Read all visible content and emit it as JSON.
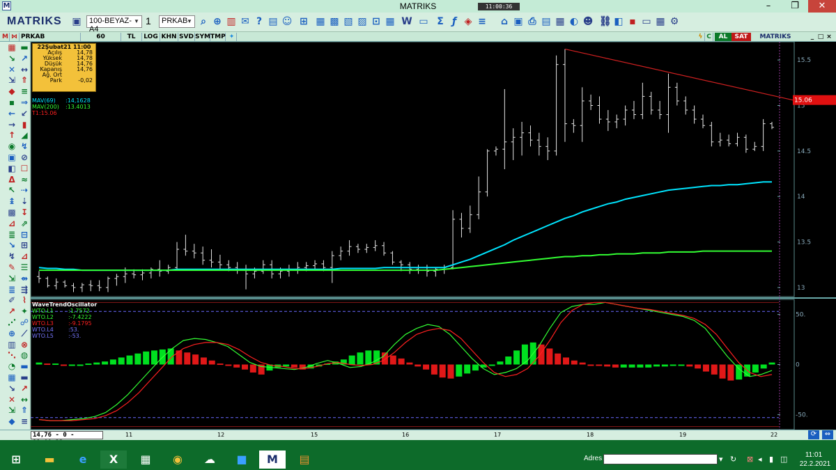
{
  "window": {
    "app_icon": "M",
    "title": "MATRIKS",
    "clock": "11:00:36",
    "minimize": "–",
    "maximize": "❐",
    "close": "✕"
  },
  "toolbar": {
    "logo": "MATRIKS",
    "template_select": "100-BEYAZ-A4",
    "window_select": "1",
    "symbol_select": "PRKAB",
    "icons": [
      "save-icon",
      "search-icon",
      "zoom-icon",
      "chart-icon",
      "email-icon",
      "help-icon",
      "bar-chart-icon",
      "news-icon",
      "web-icon",
      "table-icon",
      "tools-icon",
      "formula-icon",
      "fx-icon",
      "alert-icon",
      "bold-icon",
      "font-color-icon",
      "paint-icon",
      "settings-icon"
    ]
  },
  "chart_header": {
    "symbol": "PRKAB",
    "tabs": [
      "60",
      "TL",
      "LOG",
      "KHN",
      "SVD",
      "SYM",
      "TMP"
    ],
    "al": "AL",
    "sat": "SAT",
    "logo": "MATRIKS"
  },
  "info_box": {
    "title": "22Şubat21 11:00",
    "rows": [
      {
        "label": "Açılış",
        "value": "14,78"
      },
      {
        "label": "Yüksek",
        "value": "14,78"
      },
      {
        "label": "Düşük",
        "value": "14,76"
      },
      {
        "label": "Kapanış",
        "value": "14,76"
      },
      {
        "label": "Ağ. Ort",
        "value": ""
      },
      {
        "label": "Park",
        "value": "-0,02"
      }
    ]
  },
  "indicators_main": [
    {
      "name": "MAV(69)",
      "value": ":14,1628",
      "color": "#00e5ff"
    },
    {
      "name": "MAV(200)",
      "value": ":13.4013",
      "color": "#33ff33"
    },
    {
      "name": "T1:15.06",
      "value": "",
      "color": "#ff2020"
    }
  ],
  "indicators_osc": {
    "title": "WaveTrendOscillator",
    "lines": [
      {
        "name": "WTO.L1",
        "value": ":1.7572",
        "color": "#33ff33"
      },
      {
        "name": "WTO.L2",
        "value": ":-7.4222",
        "color": "#33ff33"
      },
      {
        "name": "WTO.L3",
        "value": ":-9.1795",
        "color": "#ff2020"
      },
      {
        "name": "WTO.L4",
        "value": ":53.",
        "color": "#7777ff"
      },
      {
        "name": "WTO.L5",
        "value": ":-53.",
        "color": "#7777ff"
      }
    ]
  },
  "chart_data": [
    {
      "type": "ohlc",
      "ylim": [
        12.9,
        15.7
      ],
      "y_ticks": [
        "15.5",
        "15",
        "14.5",
        "14",
        "13.5",
        "13"
      ],
      "price_label": "15.06",
      "trendline": {
        "from_price": 15.62,
        "to_price": 15.06
      },
      "bars": [
        [
          13.12,
          13.18,
          13.05,
          13.1
        ],
        [
          13.1,
          13.12,
          13.0,
          13.02
        ],
        [
          13.02,
          13.1,
          12.98,
          13.06
        ],
        [
          13.06,
          13.08,
          13.0,
          13.02
        ],
        [
          13.02,
          13.05,
          12.95,
          13.0
        ],
        [
          13.0,
          13.05,
          12.95,
          13.03
        ],
        [
          13.03,
          13.08,
          12.96,
          13.02
        ],
        [
          13.02,
          13.08,
          12.96,
          13.0
        ],
        [
          13.0,
          13.12,
          12.95,
          13.1
        ],
        [
          13.1,
          13.15,
          13.02,
          13.12
        ],
        [
          13.12,
          13.22,
          13.05,
          13.15
        ],
        [
          13.15,
          13.2,
          13.1,
          13.14
        ],
        [
          13.14,
          13.2,
          13.08,
          13.16
        ],
        [
          13.16,
          13.22,
          13.1,
          13.2
        ],
        [
          13.2,
          13.3,
          13.12,
          13.18
        ],
        [
          13.18,
          13.25,
          13.15,
          13.22
        ],
        [
          13.22,
          13.5,
          13.2,
          13.42
        ],
        [
          13.42,
          13.58,
          13.35,
          13.4
        ],
        [
          13.4,
          13.48,
          13.32,
          13.38
        ],
        [
          13.38,
          13.45,
          13.25,
          13.3
        ],
        [
          13.3,
          13.42,
          13.22,
          13.28
        ],
        [
          13.28,
          13.36,
          13.2,
          13.25
        ],
        [
          13.25,
          13.3,
          13.18,
          13.22
        ],
        [
          13.22,
          13.28,
          13.15,
          13.2
        ],
        [
          13.2,
          13.25,
          12.98,
          13.15
        ],
        [
          13.15,
          13.22,
          13.1,
          13.18
        ],
        [
          13.18,
          13.3,
          13.15,
          13.25
        ],
        [
          13.25,
          13.3,
          13.1,
          13.15
        ],
        [
          13.15,
          13.22,
          13.1,
          13.18
        ],
        [
          13.18,
          13.25,
          13.12,
          13.2
        ],
        [
          13.2,
          13.28,
          13.15,
          13.22
        ],
        [
          13.22,
          13.28,
          13.18,
          13.24
        ],
        [
          13.24,
          13.3,
          13.2,
          13.26
        ],
        [
          13.26,
          13.3,
          13.18,
          13.22
        ],
        [
          13.22,
          13.4,
          13.05,
          13.35
        ],
        [
          13.35,
          13.45,
          13.3,
          13.4
        ],
        [
          13.4,
          13.52,
          13.35,
          13.45
        ],
        [
          13.45,
          13.48,
          13.38,
          13.42
        ],
        [
          13.42,
          13.48,
          13.38,
          13.44
        ],
        [
          13.44,
          13.52,
          13.4,
          13.46
        ],
        [
          13.46,
          13.5,
          13.35,
          13.38
        ],
        [
          13.38,
          13.4,
          13.25,
          13.28
        ],
        [
          13.28,
          13.3,
          13.18,
          13.25
        ],
        [
          13.25,
          13.28,
          13.15,
          13.2
        ],
        [
          13.2,
          13.25,
          13.15,
          13.22
        ],
        [
          13.22,
          13.25,
          13.12,
          13.18
        ],
        [
          13.18,
          13.22,
          13.12,
          13.2
        ],
        [
          13.2,
          13.25,
          13.15,
          13.22
        ],
        [
          13.22,
          13.85,
          13.2,
          13.75
        ],
        [
          13.75,
          13.82,
          13.55,
          13.65
        ],
        [
          13.65,
          13.9,
          13.6,
          13.8
        ],
        [
          13.8,
          14.22,
          13.75,
          14.05
        ],
        [
          14.05,
          14.52,
          14.0,
          14.5
        ],
        [
          14.5,
          14.55,
          14.45,
          14.52
        ],
        [
          14.52,
          15.18,
          14.3,
          14.6
        ],
        [
          14.6,
          14.75,
          14.4,
          14.65
        ],
        [
          14.65,
          14.82,
          14.45,
          14.7
        ],
        [
          14.7,
          14.78,
          14.55,
          14.62
        ],
        [
          14.62,
          14.7,
          14.45,
          14.55
        ],
        [
          14.55,
          14.65,
          14.4,
          14.5
        ],
        [
          14.5,
          15.55,
          14.45,
          15.45
        ],
        [
          15.45,
          15.62,
          14.6,
          14.8
        ],
        [
          14.8,
          14.85,
          14.7,
          14.78
        ],
        [
          14.78,
          15.2,
          14.6,
          15.05
        ],
        [
          15.05,
          15.12,
          14.95,
          15.0
        ],
        [
          15.0,
          15.1,
          14.8,
          14.85
        ],
        [
          14.85,
          14.95,
          14.72,
          14.82
        ],
        [
          14.82,
          14.9,
          14.75,
          14.85
        ],
        [
          14.85,
          15.0,
          14.78,
          14.95
        ],
        [
          14.95,
          15.05,
          14.85,
          14.9
        ],
        [
          14.9,
          15.25,
          14.85,
          15.1
        ],
        [
          15.1,
          15.15,
          14.9,
          14.95
        ],
        [
          14.95,
          15.05,
          14.85,
          14.9
        ],
        [
          14.9,
          15.35,
          14.7,
          15.2
        ],
        [
          15.2,
          15.25,
          15.0,
          15.05
        ],
        [
          15.05,
          15.1,
          14.9,
          14.95
        ],
        [
          14.95,
          15.0,
          14.8,
          14.85
        ],
        [
          14.85,
          14.9,
          14.75,
          14.78
        ],
        [
          14.78,
          14.82,
          14.55,
          14.6
        ],
        [
          14.6,
          14.7,
          14.55,
          14.62
        ],
        [
          14.62,
          14.68,
          14.55,
          14.58
        ],
        [
          14.58,
          14.7,
          14.55,
          14.65
        ],
        [
          14.65,
          14.68,
          14.48,
          14.52
        ],
        [
          14.52,
          14.6,
          14.5,
          14.55
        ],
        [
          14.55,
          14.85,
          14.5,
          14.8
        ],
        [
          14.8,
          14.82,
          14.74,
          14.76
        ]
      ],
      "series": [
        {
          "name": "MAV(69)",
          "color": "#00e5ff",
          "values": [
            13.22,
            13.21,
            13.21,
            13.2,
            13.2,
            13.19,
            13.19,
            13.19,
            13.19,
            13.19,
            13.19,
            13.19,
            13.19,
            13.19,
            13.19,
            13.19,
            13.2,
            13.2,
            13.2,
            13.2,
            13.2,
            13.2,
            13.2,
            13.2,
            13.2,
            13.2,
            13.2,
            13.2,
            13.2,
            13.2,
            13.2,
            13.2,
            13.2,
            13.2,
            13.2,
            13.21,
            13.21,
            13.21,
            13.21,
            13.21,
            13.22,
            13.22,
            13.22,
            13.22,
            13.22,
            13.22,
            13.22,
            13.22,
            13.25,
            13.28,
            13.31,
            13.35,
            13.39,
            13.43,
            13.47,
            13.52,
            13.56,
            13.6,
            13.64,
            13.68,
            13.72,
            13.76,
            13.79,
            13.83,
            13.86,
            13.89,
            13.92,
            13.94,
            13.97,
            13.99,
            14.01,
            14.03,
            14.05,
            14.07,
            14.08,
            14.09,
            14.1,
            14.11,
            14.12,
            14.12,
            14.13,
            14.13,
            14.14,
            14.15,
            14.16,
            14.16
          ]
        },
        {
          "name": "MAV(200)",
          "color": "#33ff33",
          "values": [
            13.19,
            13.19,
            13.19,
            13.19,
            13.19,
            13.19,
            13.19,
            13.19,
            13.19,
            13.19,
            13.19,
            13.19,
            13.19,
            13.19,
            13.19,
            13.19,
            13.19,
            13.19,
            13.19,
            13.19,
            13.19,
            13.19,
            13.19,
            13.19,
            13.19,
            13.19,
            13.19,
            13.19,
            13.19,
            13.19,
            13.19,
            13.19,
            13.19,
            13.19,
            13.19,
            13.19,
            13.19,
            13.19,
            13.19,
            13.19,
            13.19,
            13.19,
            13.19,
            13.19,
            13.19,
            13.19,
            13.19,
            13.2,
            13.21,
            13.22,
            13.23,
            13.24,
            13.25,
            13.26,
            13.27,
            13.28,
            13.29,
            13.3,
            13.31,
            13.32,
            13.33,
            13.34,
            13.34,
            13.35,
            13.35,
            13.36,
            13.36,
            13.37,
            13.37,
            13.37,
            13.38,
            13.38,
            13.38,
            13.39,
            13.39,
            13.39,
            13.39,
            13.4,
            13.4,
            13.4,
            13.4,
            13.4,
            13.4,
            13.4,
            13.4,
            13.4
          ]
        }
      ]
    },
    {
      "type": "oscillator",
      "ylim": [
        -65,
        65
      ],
      "y_ticks": [
        "50.",
        "0",
        "-50."
      ],
      "levels": [
        53,
        -53
      ],
      "histogram": [
        2,
        1,
        1,
        -1,
        -1,
        0,
        1,
        2,
        3,
        5,
        7,
        9,
        11,
        13,
        14,
        15,
        16,
        14,
        12,
        10,
        7,
        4,
        1,
        -1,
        -3,
        -5,
        -8,
        -10,
        -6,
        -3,
        -2,
        -3,
        -5,
        -4,
        -2,
        1,
        3,
        5,
        9,
        12,
        14,
        14,
        12,
        9,
        6,
        2,
        -2,
        -5,
        -10,
        -13,
        -14,
        -12,
        -9,
        -6,
        -3,
        -1,
        3,
        8,
        14,
        20,
        22,
        20,
        16,
        11,
        7,
        4,
        2,
        0,
        -1,
        -2,
        -3,
        -3,
        -3,
        -3,
        -3,
        -2,
        -2,
        -1,
        -1,
        -2,
        -4,
        -7,
        -10,
        -14,
        -16,
        -15,
        -12,
        -8,
        -4,
        2
      ],
      "series": [
        {
          "name": "WTO.L1",
          "color": "#33ff33",
          "values": [
            -55,
            -56,
            -56,
            -55,
            -54,
            -52,
            -48,
            -40,
            -30,
            -18,
            -6,
            6,
            16,
            24,
            26,
            25,
            22,
            18,
            10,
            2,
            -2,
            -3,
            -4,
            -5,
            -3,
            1,
            4,
            1,
            -3,
            -2,
            2,
            8,
            20,
            30,
            36,
            40,
            38,
            30,
            18,
            6,
            -4,
            -10,
            -8,
            -4,
            4,
            18,
            36,
            52,
            58,
            60,
            60,
            62,
            60,
            58,
            56,
            54,
            52,
            50,
            48,
            44,
            36,
            22,
            8,
            -4,
            -12,
            -10,
            -6
          ]
        },
        {
          "name": "WTO.L2",
          "color": "#ff2020",
          "values": [
            -55,
            -56,
            -56,
            -56,
            -55,
            -54,
            -51,
            -46,
            -38,
            -28,
            -16,
            -4,
            8,
            16,
            20,
            22,
            22,
            20,
            15,
            8,
            2,
            -1,
            -2,
            -4,
            -4,
            -2,
            1,
            2,
            0,
            -1,
            0,
            4,
            12,
            22,
            30,
            34,
            36,
            34,
            26,
            14,
            2,
            -8,
            -12,
            -10,
            -4,
            8,
            24,
            42,
            54,
            60,
            62,
            62,
            60,
            58,
            56,
            55,
            53,
            51,
            49,
            46,
            40,
            30,
            16,
            2,
            -8,
            -12,
            -10
          ]
        }
      ]
    }
  ],
  "status_bar": {
    "readout": "14,76 - 0 - 11:00:33",
    "x_ticks": [
      "11",
      "12",
      "15",
      "16",
      "17",
      "18",
      "19",
      "22"
    ]
  },
  "taskbar": {
    "tasks": [
      "windows-start-icon",
      "file-explorer-icon",
      "internet-explorer-icon",
      "excel-icon",
      "calculator-icon",
      "chrome-icon",
      "onedrive-icon",
      "zoom-icon",
      "matriks-icon",
      "notes-icon"
    ],
    "address_label": "Adres",
    "address_value": "",
    "time": "11:01",
    "date": "22.2.2021"
  }
}
